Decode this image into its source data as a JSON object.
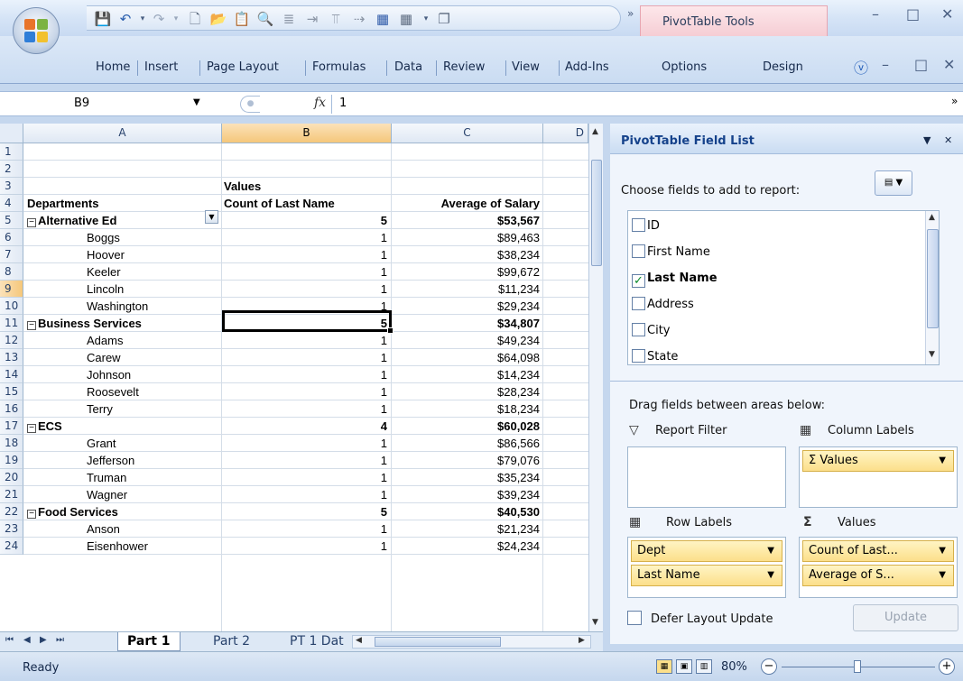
{
  "window": {
    "contextual_tab_group": "PivotTable Tools",
    "qat_overflow": "»"
  },
  "ribbon": {
    "tabs": [
      "Home",
      "Insert",
      "Page Layout",
      "Formulas",
      "Data",
      "Review",
      "View",
      "Add-Ins",
      "Options",
      "Design"
    ]
  },
  "formula_bar": {
    "name_box": "B9",
    "fx": "fx",
    "value": "1"
  },
  "sheet": {
    "columns": [
      "A",
      "B",
      "C",
      "D"
    ],
    "selected_column": "B",
    "selected_row": 9,
    "rows": [
      {
        "n": "1",
        "a": "",
        "b": "",
        "c": "",
        "type": "blank"
      },
      {
        "n": "2",
        "a": "",
        "b": "",
        "c": "",
        "type": "blank"
      },
      {
        "n": "3",
        "a": "",
        "b": "Values",
        "c": "",
        "type": "header"
      },
      {
        "n": "4",
        "a": "Departments",
        "b": "Count of Last Name",
        "c": "Average of Salary",
        "type": "header"
      },
      {
        "n": "5",
        "a": "Alternative Ed",
        "b": "5",
        "c": "$53,567",
        "type": "group"
      },
      {
        "n": "6",
        "a": "Boggs",
        "b": "1",
        "c": "$89,463",
        "type": "item"
      },
      {
        "n": "7",
        "a": "Hoover",
        "b": "1",
        "c": "$38,234",
        "type": "item"
      },
      {
        "n": "8",
        "a": "Keeler",
        "b": "1",
        "c": "$99,672",
        "type": "item"
      },
      {
        "n": "9",
        "a": "Lincoln",
        "b": "1",
        "c": "$11,234",
        "type": "item"
      },
      {
        "n": "10",
        "a": "Washington",
        "b": "1",
        "c": "$29,234",
        "type": "item"
      },
      {
        "n": "11",
        "a": "Business Services",
        "b": "5",
        "c": "$34,807",
        "type": "group"
      },
      {
        "n": "12",
        "a": "Adams",
        "b": "1",
        "c": "$49,234",
        "type": "item"
      },
      {
        "n": "13",
        "a": "Carew",
        "b": "1",
        "c": "$64,098",
        "type": "item"
      },
      {
        "n": "14",
        "a": "Johnson",
        "b": "1",
        "c": "$14,234",
        "type": "item"
      },
      {
        "n": "15",
        "a": "Roosevelt",
        "b": "1",
        "c": "$28,234",
        "type": "item"
      },
      {
        "n": "16",
        "a": "Terry",
        "b": "1",
        "c": "$18,234",
        "type": "item"
      },
      {
        "n": "17",
        "a": "ECS",
        "b": "4",
        "c": "$60,028",
        "type": "group"
      },
      {
        "n": "18",
        "a": "Grant",
        "b": "1",
        "c": "$86,566",
        "type": "item"
      },
      {
        "n": "19",
        "a": "Jefferson",
        "b": "1",
        "c": "$79,076",
        "type": "item"
      },
      {
        "n": "20",
        "a": "Truman",
        "b": "1",
        "c": "$35,234",
        "type": "item"
      },
      {
        "n": "21",
        "a": "Wagner",
        "b": "1",
        "c": "$39,234",
        "type": "item"
      },
      {
        "n": "22",
        "a": "Food Services",
        "b": "5",
        "c": "$40,530",
        "type": "group"
      },
      {
        "n": "23",
        "a": "Anson",
        "b": "1",
        "c": "$21,234",
        "type": "item"
      },
      {
        "n": "24",
        "a": "Eisenhower",
        "b": "1",
        "c": "$24,234",
        "type": "item"
      }
    ]
  },
  "sheet_tabs": {
    "tabs": [
      "Part 1",
      "Part 2",
      "PT 1 Dat"
    ],
    "active": "Part 1"
  },
  "pivot_pane": {
    "title": "PivotTable Field List",
    "choose_label": "Choose fields to add to report:",
    "fields": [
      {
        "label": "ID",
        "checked": false
      },
      {
        "label": "First Name",
        "checked": false
      },
      {
        "label": "Last Name",
        "checked": true
      },
      {
        "label": "Address",
        "checked": false
      },
      {
        "label": "City",
        "checked": false
      },
      {
        "label": "State",
        "checked": false
      }
    ],
    "drag_label": "Drag fields between areas below:",
    "report_filter_label": "Report Filter",
    "column_labels_label": "Column Labels",
    "row_labels_label": "Row Labels",
    "values_label": "Values",
    "column_items": [
      "Σ Values"
    ],
    "row_items": [
      "Dept",
      "Last Name"
    ],
    "value_items": [
      "Count of Last...",
      "Average of S..."
    ],
    "defer_label": "Defer Layout Update",
    "update_label": "Update"
  },
  "status_bar": {
    "status": "Ready",
    "zoom": "80%"
  }
}
